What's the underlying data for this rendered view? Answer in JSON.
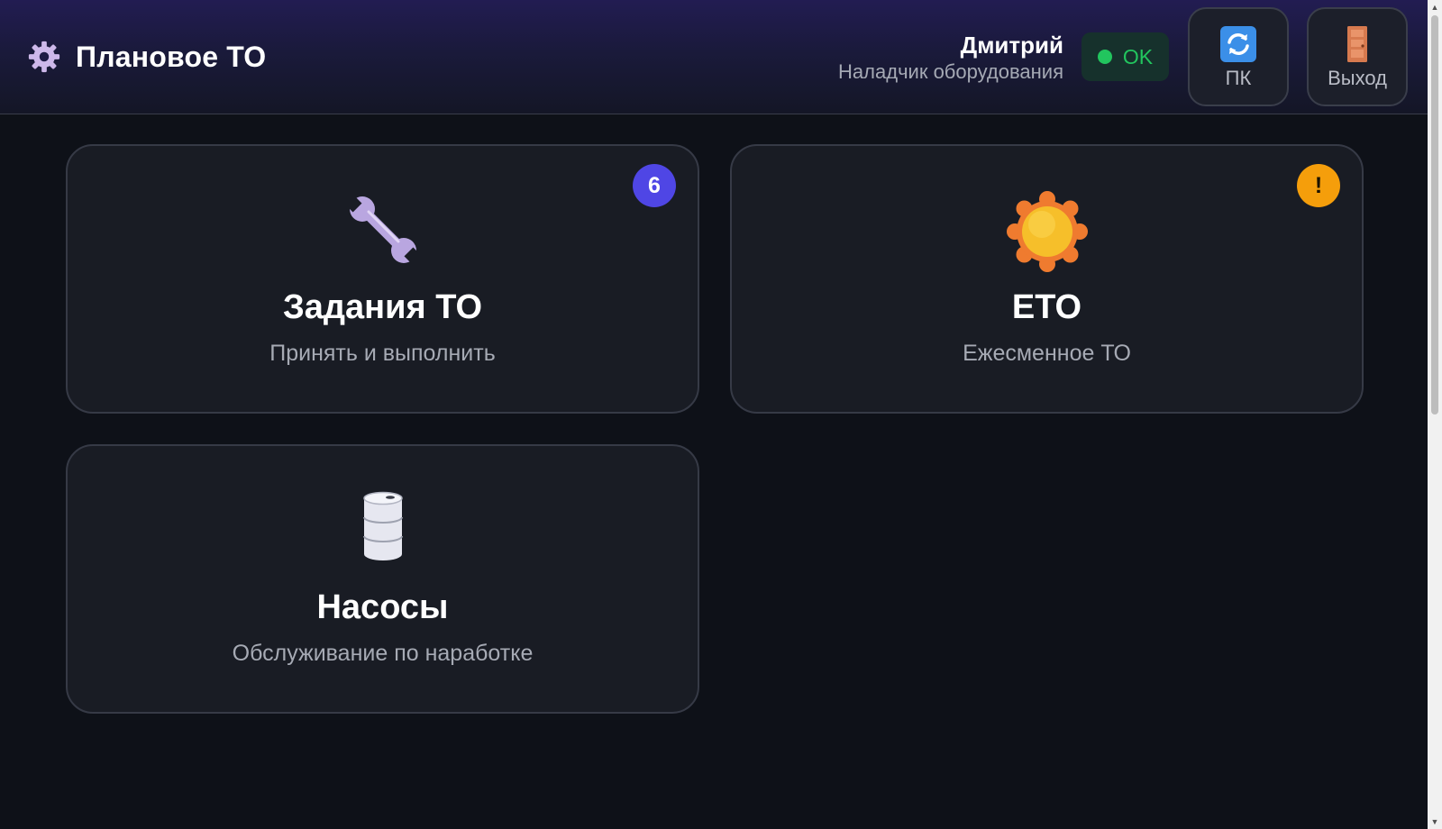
{
  "header": {
    "title": "Плановое ТО",
    "brand_icon": "gear-icon",
    "user_name": "Дмитрий",
    "user_role": "Наладчик оборудования",
    "status_text": "OK",
    "status_color": "#22c55e",
    "sync_button": {
      "label": "ПК",
      "icon": "sync-icon"
    },
    "exit_button": {
      "label": "Выход",
      "icon": "door-icon"
    }
  },
  "cards": [
    {
      "title": "Задания ТО",
      "subtitle": "Принять и выполнить",
      "icon": "wrench-icon",
      "badge": "6",
      "badge_color": "#4f46e5"
    },
    {
      "title": "ЕТО",
      "subtitle": "Ежесменное ТО",
      "icon": "sun-icon",
      "badge": "!",
      "badge_color": "#f59e0b"
    },
    {
      "title": "Насосы",
      "subtitle": "Обслуживание по наработке",
      "icon": "barrel-icon"
    }
  ],
  "colors": {
    "background": "#0e1118",
    "card": "#191c24",
    "header_accent": "#221c52"
  }
}
